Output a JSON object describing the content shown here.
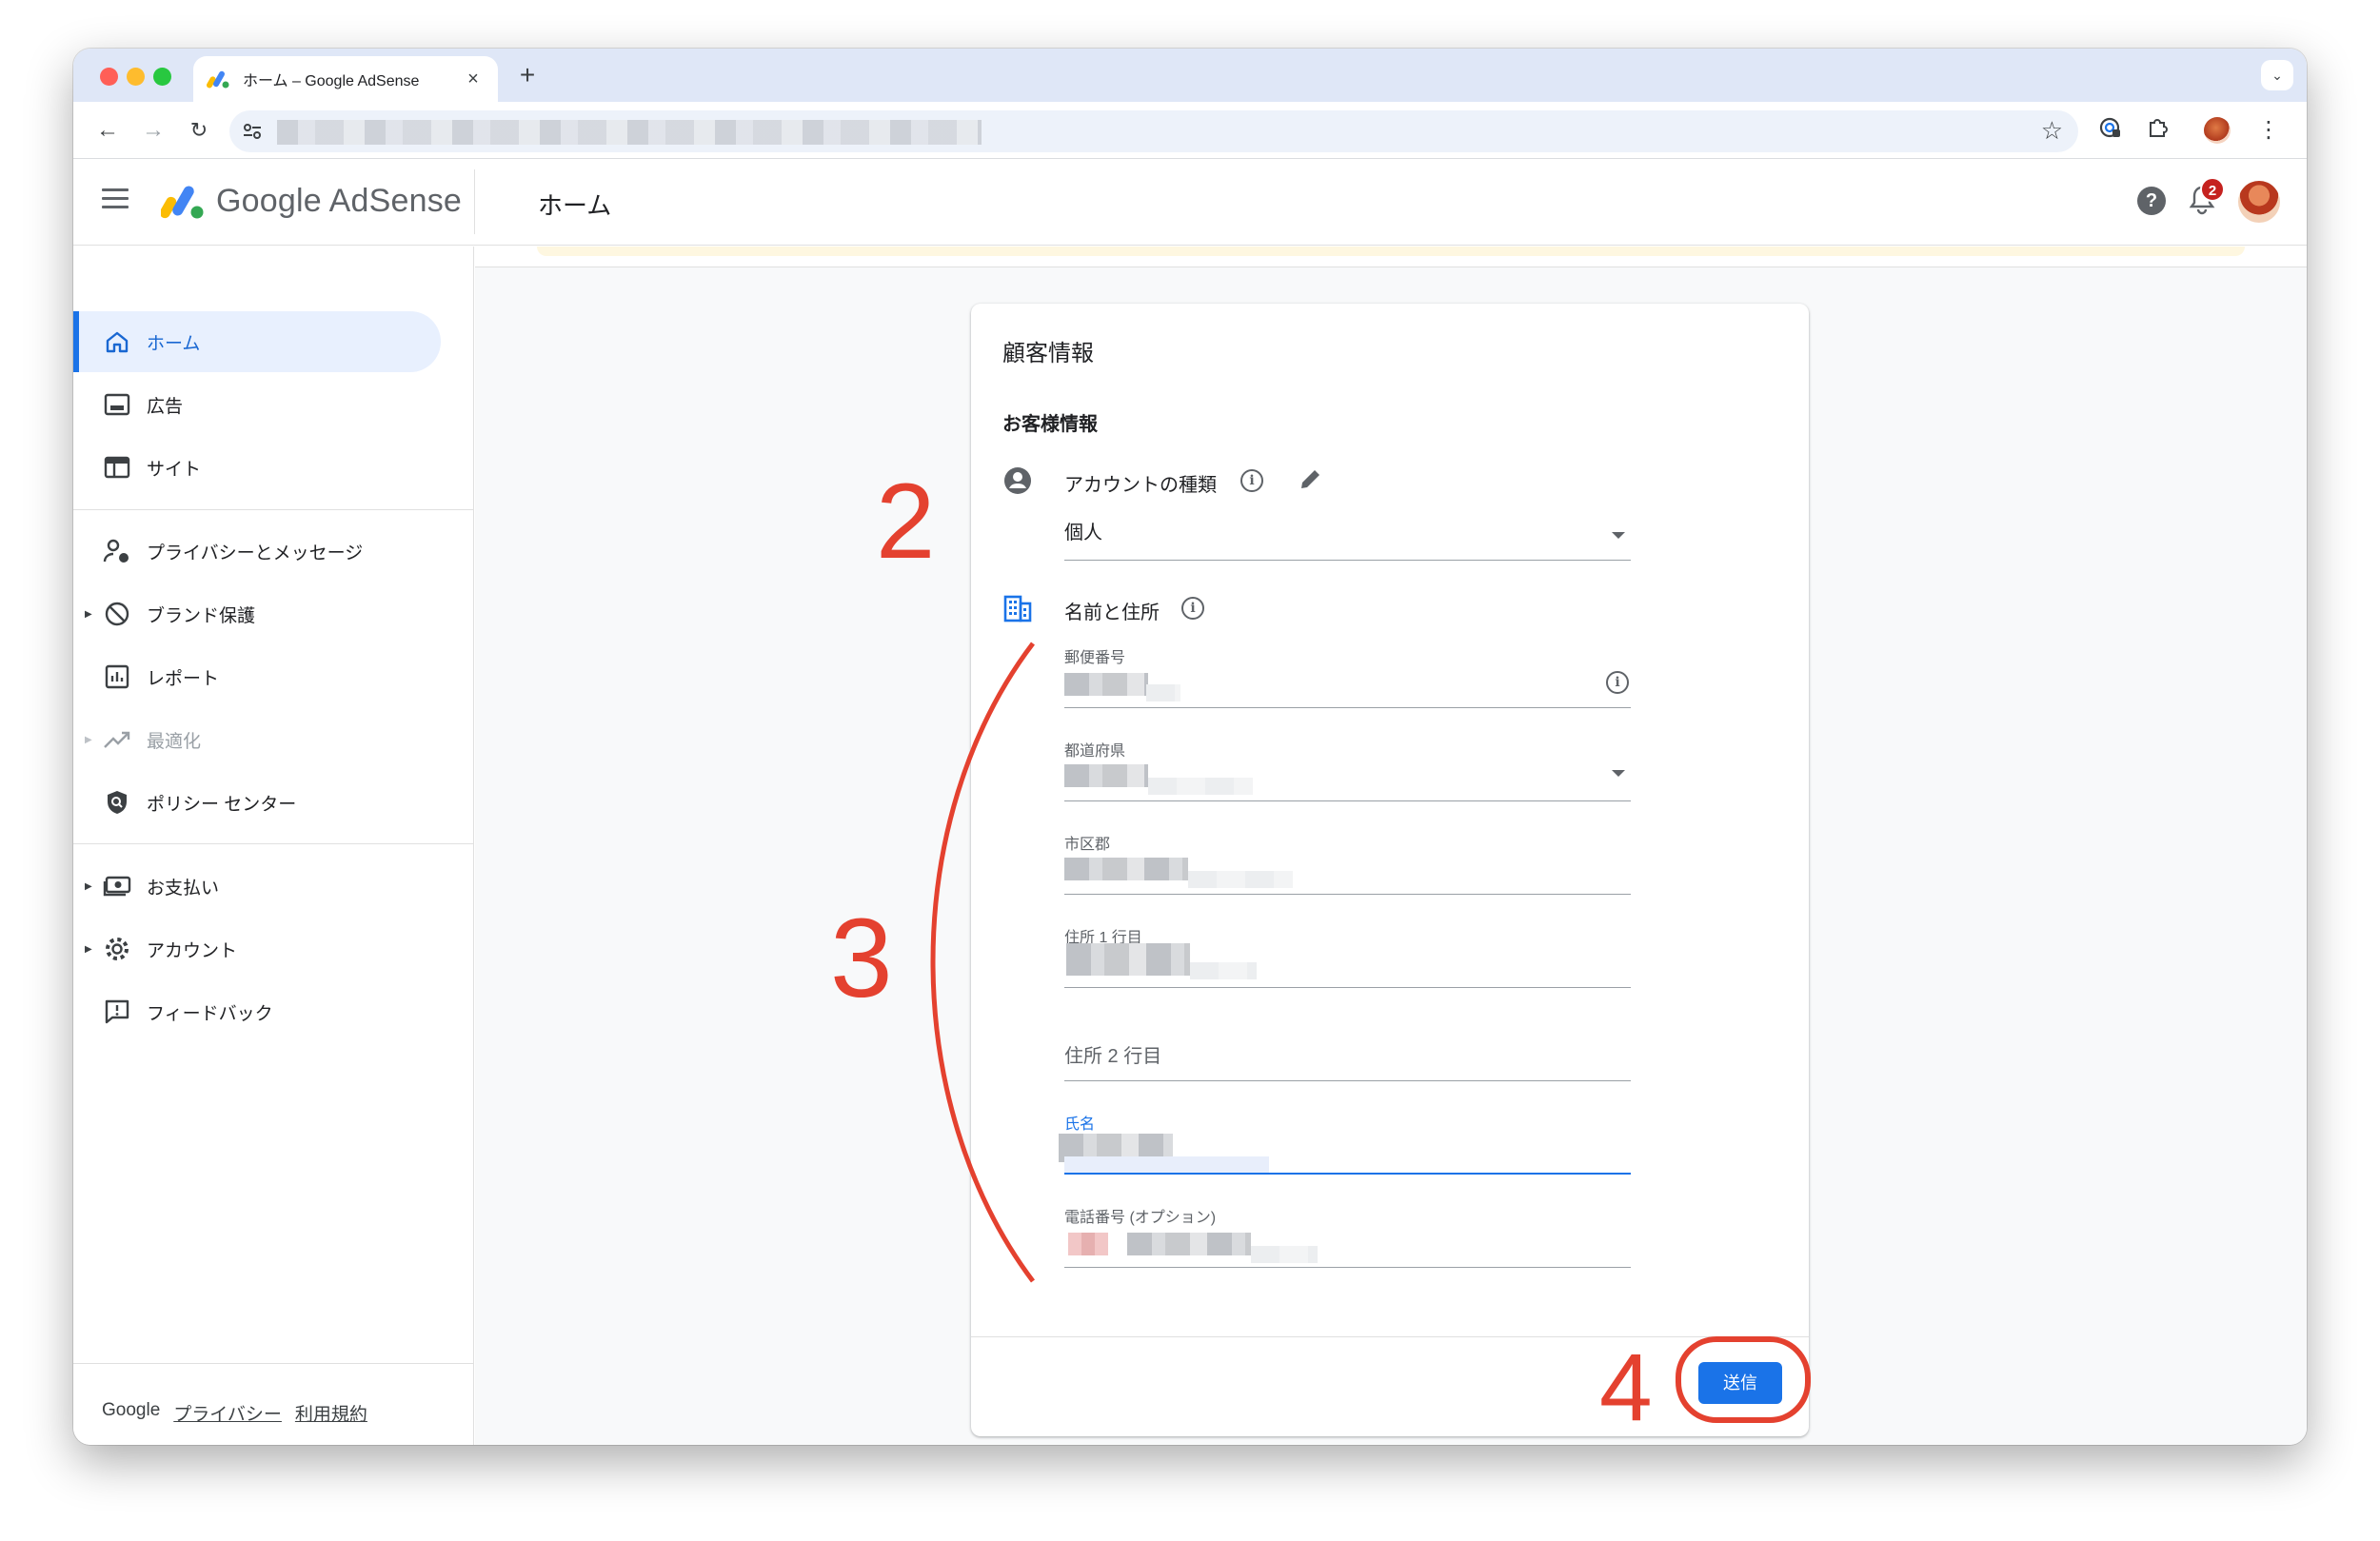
{
  "browser": {
    "tab_title": "ホーム – Google AdSense",
    "tab_close": "×",
    "new_tab": "+",
    "tab_dropdown": "⌄"
  },
  "header": {
    "brand": "Google AdSense",
    "page_title": "ホーム",
    "help": "?",
    "notification_count": "2"
  },
  "sidebar": {
    "items": [
      {
        "label": "ホーム"
      },
      {
        "label": "広告"
      },
      {
        "label": "サイト"
      },
      {
        "label": "プライバシーとメッセージ"
      },
      {
        "label": "ブランド保護"
      },
      {
        "label": "レポート"
      },
      {
        "label": "最適化"
      },
      {
        "label": "ポリシー センター"
      },
      {
        "label": "お支払い"
      },
      {
        "label": "アカウント"
      },
      {
        "label": "フィードバック"
      }
    ],
    "footer": {
      "google": "Google",
      "privacy": "プライバシー",
      "terms": "利用規約"
    }
  },
  "card": {
    "title": "顧客情報",
    "section_title": "お客様情報",
    "account_type_label": "アカウントの種類",
    "account_type_value": "個人",
    "name_address_label": "名前と住所",
    "fields": {
      "postal": "郵便番号",
      "prefecture": "都道府県",
      "city": "市区郡",
      "address1": "住所 1 行目",
      "address2": "住所 2 行目",
      "name": "氏名",
      "phone": "電話番号 (オプション)"
    },
    "submit": "送信"
  },
  "annotations": {
    "step2": "2",
    "step3": "3",
    "step4": "4",
    "color": "#e4412f"
  },
  "colors": {
    "accent": "#1a73e8",
    "tabstrip": "#dfe7f7",
    "badge": "#c5221f"
  }
}
